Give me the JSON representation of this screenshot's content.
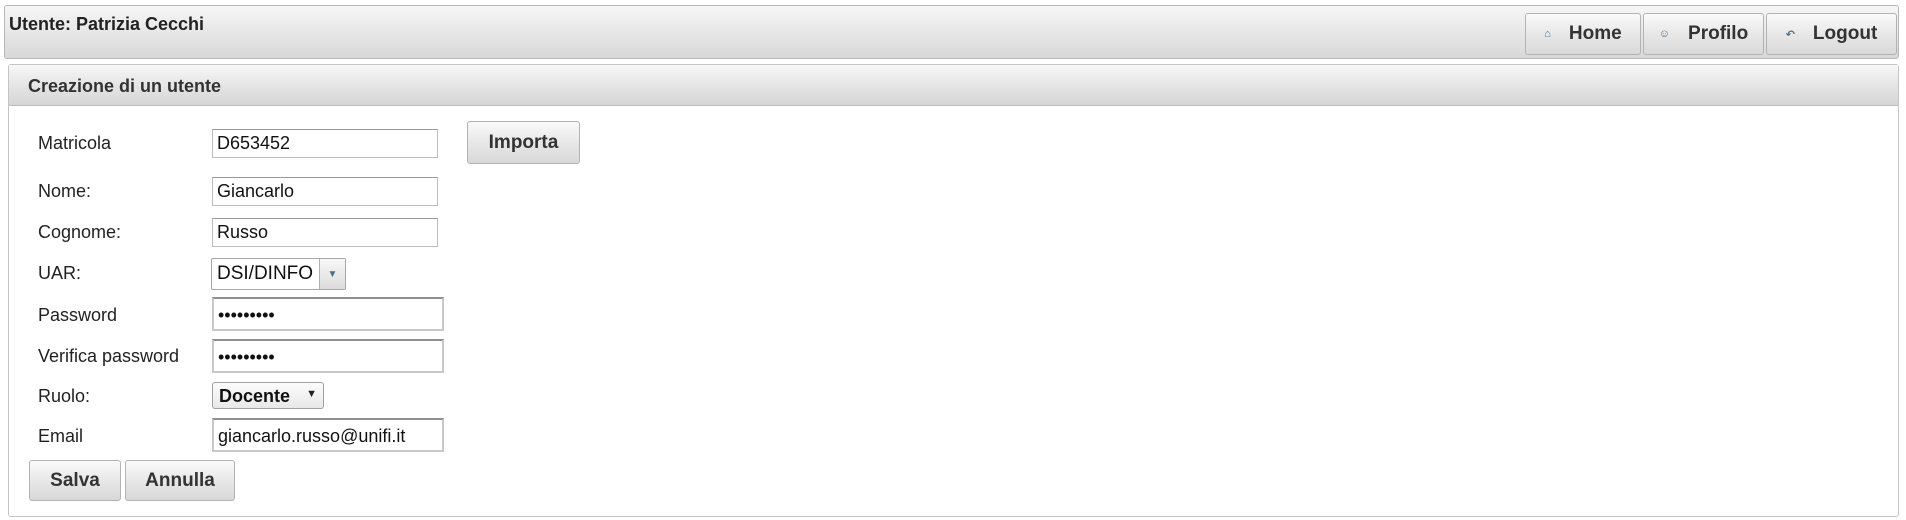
{
  "header": {
    "user_label": "Utente: Patrizia Cecchi",
    "nav": {
      "home": "Home",
      "profilo": "Profilo",
      "logout": "Logout"
    }
  },
  "panel": {
    "title": "Creazione di un utente"
  },
  "form": {
    "matricola": {
      "label": "Matricola",
      "value": "D653452"
    },
    "importa_label": "Importa",
    "nome": {
      "label": "Nome:",
      "value": "Giancarlo"
    },
    "cognome": {
      "label": "Cognome:",
      "value": "Russo"
    },
    "uar": {
      "label": "UAR:",
      "value": "DSI/DINFO"
    },
    "password": {
      "label": "Password",
      "value": "•••••••••"
    },
    "verifica_password": {
      "label": "Verifica password",
      "value": "•••••••••"
    },
    "ruolo": {
      "label": "Ruolo:",
      "value": "Docente"
    },
    "email": {
      "label": "Email",
      "value": "giancarlo.russo@unifi.it"
    }
  },
  "actions": {
    "salva": "Salva",
    "annulla": "Annulla"
  },
  "icons": {
    "home": "home-icon",
    "profilo": "user-icon",
    "logout": "logout-icon",
    "dropdown": "chevron-down-icon"
  },
  "colors": {
    "icon_accent": "#4a6f86",
    "bar_gradient_top": "#f6f6f6",
    "bar_gradient_bottom": "#d8d8d8"
  }
}
